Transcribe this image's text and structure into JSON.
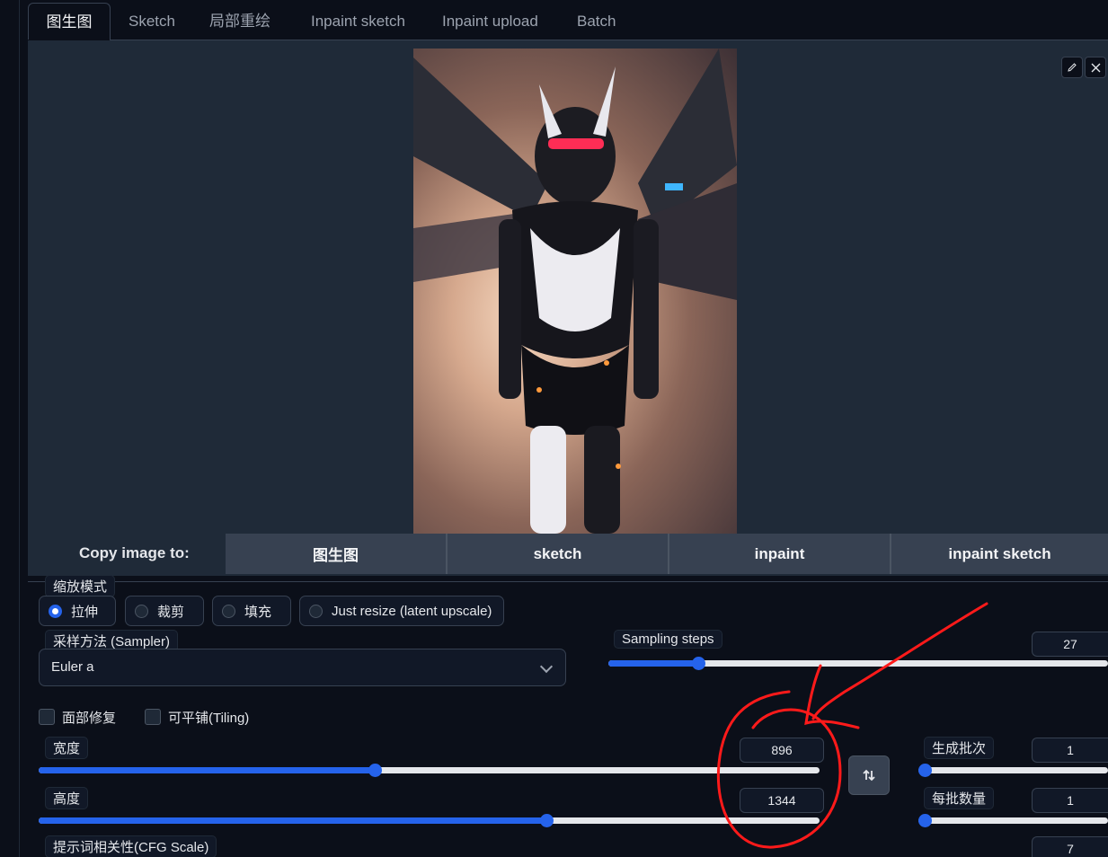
{
  "tabs": [
    {
      "label": "图生图",
      "active": true
    },
    {
      "label": "Sketch"
    },
    {
      "label": "局部重绘"
    },
    {
      "label": "Inpaint sketch"
    },
    {
      "label": "Inpaint upload"
    },
    {
      "label": "Batch"
    }
  ],
  "image_panel": {
    "edit_icon": "pencil-icon",
    "close_icon": "close-icon"
  },
  "copy_to": {
    "label": "Copy image to:",
    "buttons": [
      "图生图",
      "sketch",
      "inpaint",
      "inpaint sketch"
    ]
  },
  "resize_mode": {
    "label": "缩放模式",
    "options": [
      "拉伸",
      "裁剪",
      "填充",
      "Just resize (latent upscale)"
    ],
    "selected": "拉伸"
  },
  "sampler": {
    "label": "采样方法 (Sampler)",
    "value": "Euler a"
  },
  "sampling_steps": {
    "label": "Sampling steps",
    "value": "27",
    "level": 0.18
  },
  "checkboxes": {
    "restore_faces": "面部修复",
    "tiling": "可平铺(Tiling)"
  },
  "width": {
    "label": "宽度",
    "value": "896",
    "level": 0.43
  },
  "height": {
    "label": "高度",
    "value": "1344",
    "level": 0.65
  },
  "batch_count": {
    "label": "生成批次",
    "value": "1",
    "level": 0.0
  },
  "batch_size": {
    "label": "每批数量",
    "value": "1",
    "level": 0.0
  },
  "cfg_scale": {
    "label": "提示词相关性(CFG Scale)",
    "value": "7"
  },
  "swap_icon": "swap-vertical-icon",
  "colors": {
    "accent": "#2563eb",
    "annotation": "#ff1a1a",
    "background": "#0b0f19"
  }
}
